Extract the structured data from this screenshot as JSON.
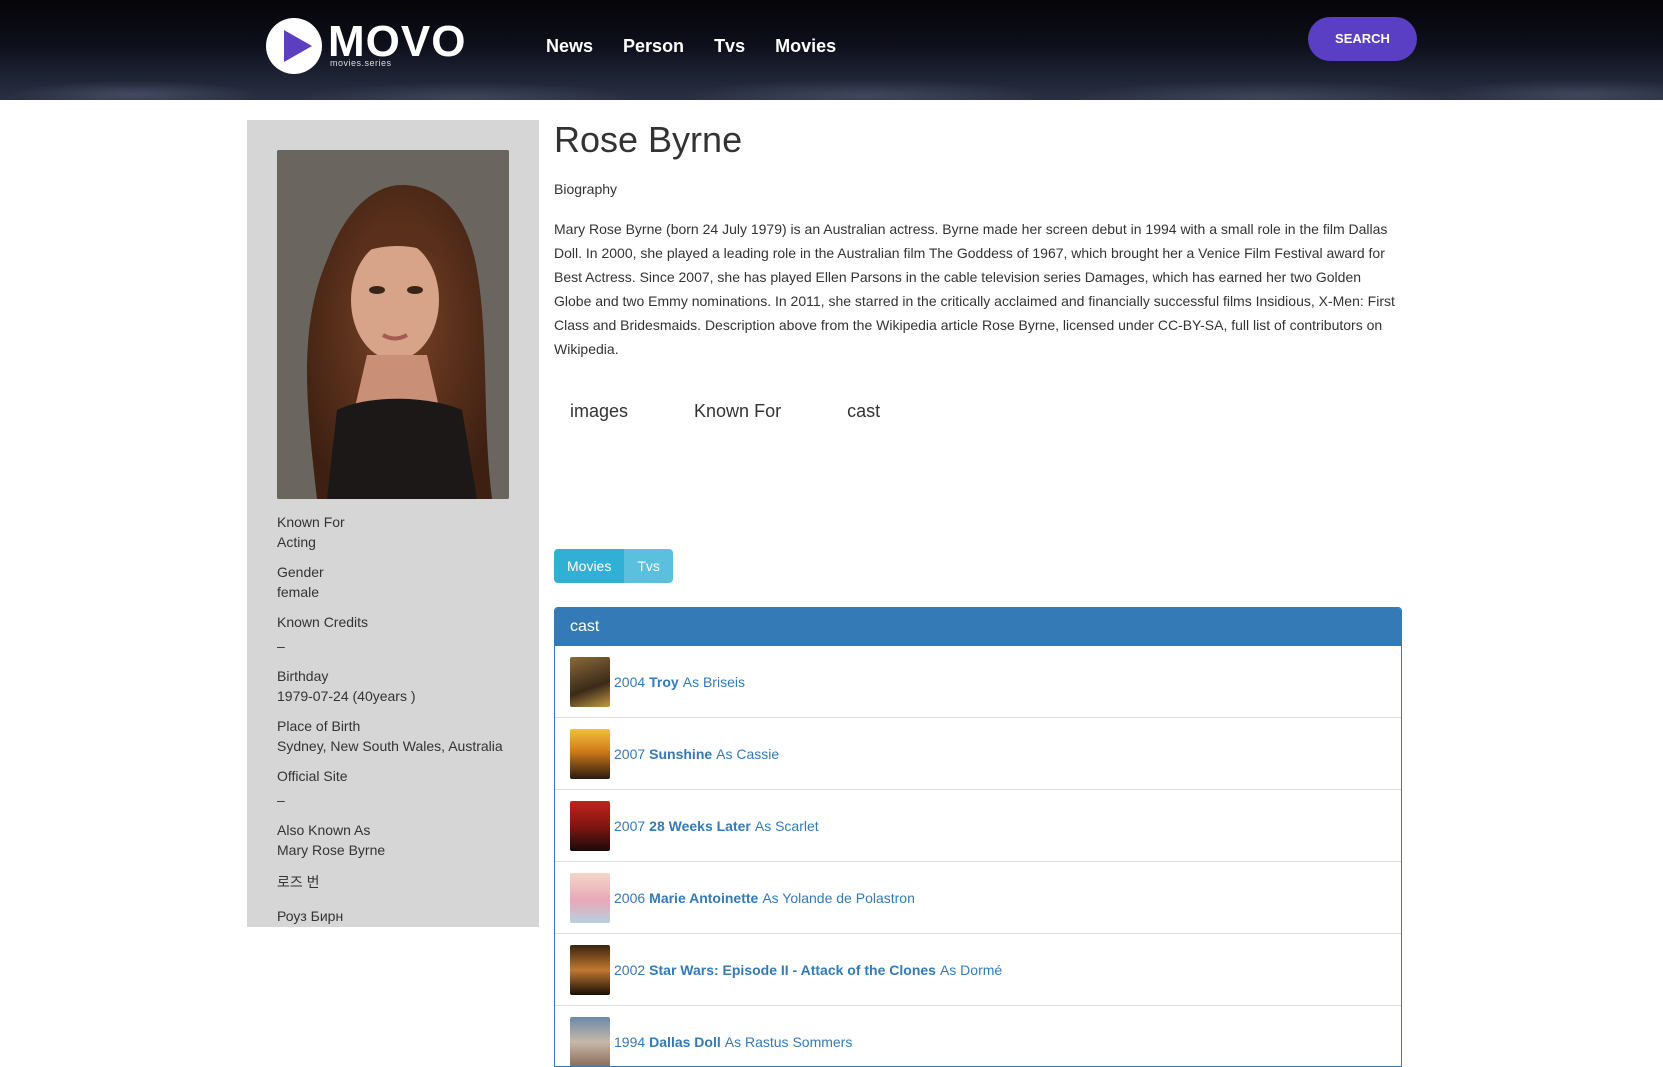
{
  "header": {
    "logo_text": "MOVO",
    "logo_sub": "movies.series",
    "nav": [
      "News",
      "Person",
      "Tvs",
      "Movies"
    ],
    "search_label": "SEARCH"
  },
  "person": {
    "name": "Rose Byrne",
    "bio_label": "Biography",
    "bio": "Mary Rose Byrne (born 24 July 1979) is an Australian actress. Byrne made her screen debut in 1994 with a small role in the film Dallas Doll. In 2000, she played a leading role in the Australian film The Goddess of 1967, which brought her a Venice Film Festival award for Best Actress. Since 2007, she has played Ellen Parsons in the cable television series Damages, which has earned her two Golden Globe and two Emmy nominations. In 2011, she starred in the critically acclaimed and financially successful films Insidious, X-Men: First Class and Bridesmaids. Description above from the Wikipedia article Rose Byrne, licensed under CC-BY-SA, full list of contributors on Wikipedia."
  },
  "sidebar": {
    "known_for_label": "Known For",
    "known_for_value": "Acting",
    "gender_label": "Gender",
    "gender_value": "female",
    "known_credits_label": "Known Credits",
    "known_credits_value": "–",
    "birthday_label": "Birthday",
    "birthday_value": "1979-07-24 (40years )",
    "place_label": "Place of Birth",
    "place_value": "Sydney, New South Wales, Australia",
    "site_label": "Official Site",
    "site_value": "–",
    "aka_label": "Also Known As",
    "aka": [
      "Mary Rose Byrne",
      "로즈 번",
      "Роуз Бирн"
    ]
  },
  "tabs": [
    "images",
    "Known For",
    "cast"
  ],
  "toggle": {
    "movies": "Movies",
    "tvs": "Tvs"
  },
  "cast_panel": {
    "title": "cast",
    "credits": [
      {
        "year": "2004",
        "title": "Troy",
        "role": "As Briseis"
      },
      {
        "year": "2007",
        "title": "Sunshine",
        "role": "As Cassie"
      },
      {
        "year": "2007",
        "title": "28 Weeks Later",
        "role": "As Scarlet"
      },
      {
        "year": "2006",
        "title": "Marie Antoinette",
        "role": "As Yolande de Polastron"
      },
      {
        "year": "2002",
        "title": "Star Wars: Episode II - Attack of the Clones",
        "role": "As Dormé"
      },
      {
        "year": "1994",
        "title": "Dallas Doll",
        "role": "As Rastus Sommers"
      }
    ]
  }
}
